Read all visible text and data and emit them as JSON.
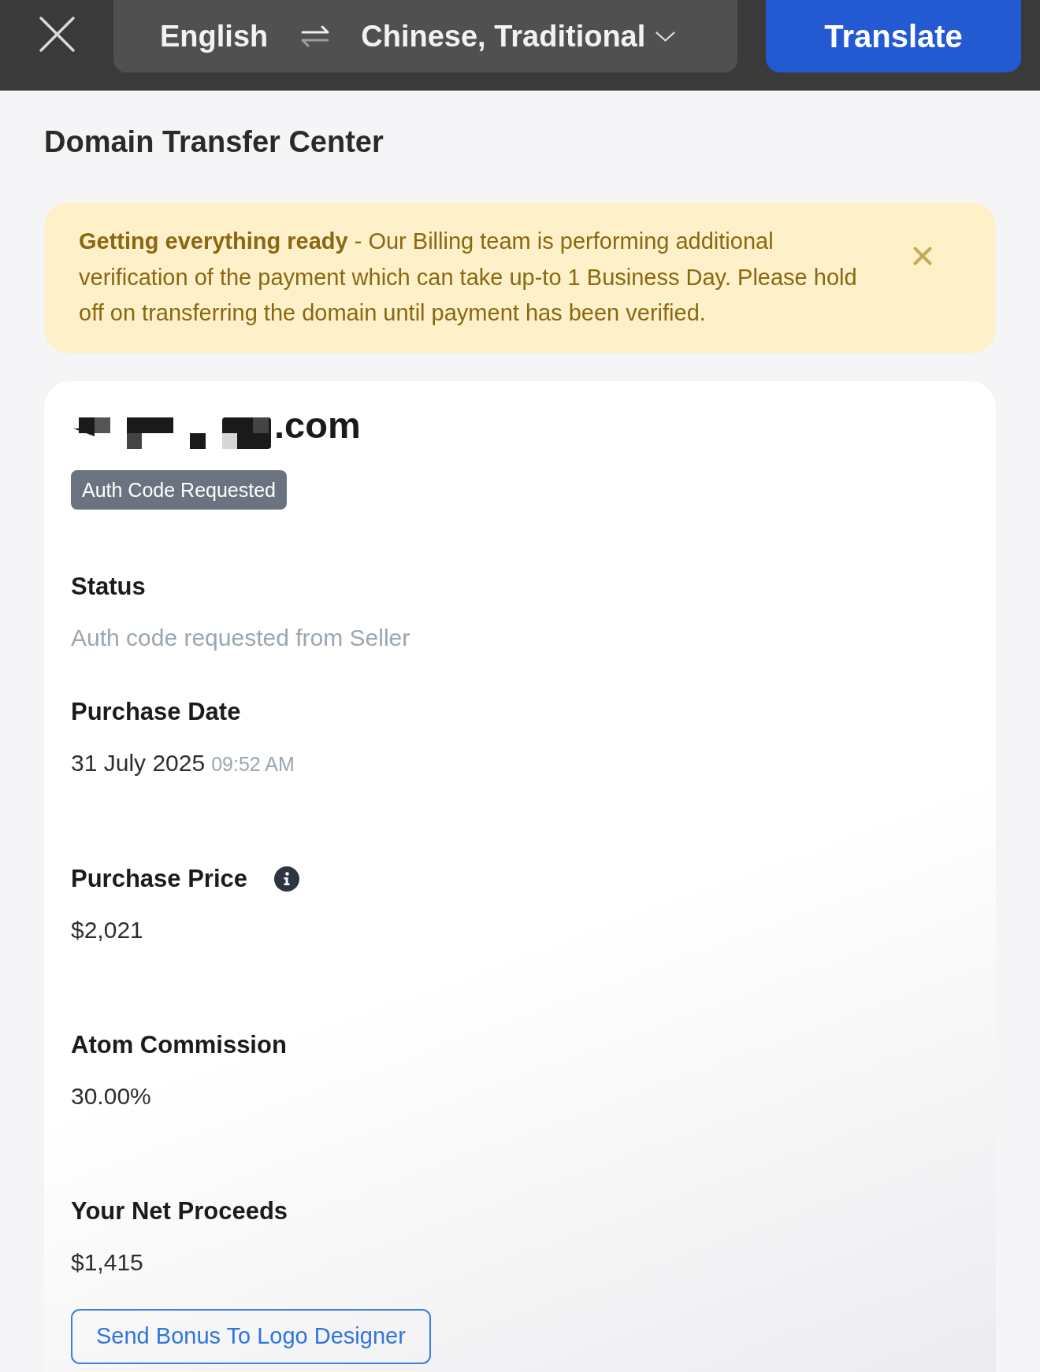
{
  "top_bar": {
    "source_language": "English",
    "target_language": "Chinese, Traditional",
    "translate_button": "Translate"
  },
  "page_title": "Domain Transfer Center",
  "alert": {
    "message": "**Getting everything ready** - Our Billing team is performing additional verification of the payment which can take up-to 1 Business Day. Please hold off on transferring the domain until payment has been verified."
  },
  "card": {
    "domain": {
      "redacted": true,
      "suffix": ".com"
    },
    "badge": "Auth Code Requested",
    "fields": [
      {
        "kind": "status",
        "label": "Status",
        "info": false,
        "value": "Auth code requested from Seller"
      },
      {
        "kind": "date",
        "label": "Purchase Date",
        "info": false,
        "value": "31 July 2025",
        "time": "09:52 AM"
      },
      {
        "kind": "amount",
        "label": "Purchase Price",
        "info": true,
        "value": "$2,021"
      },
      {
        "kind": "amount",
        "label": "Atom Commission",
        "info": false,
        "value": "30.00%"
      },
      {
        "kind": "amount",
        "label": "Your Net Proceeds",
        "info": false,
        "value": "$1,415"
      }
    ],
    "action_button": "Send Bonus To Logo Designer"
  }
}
